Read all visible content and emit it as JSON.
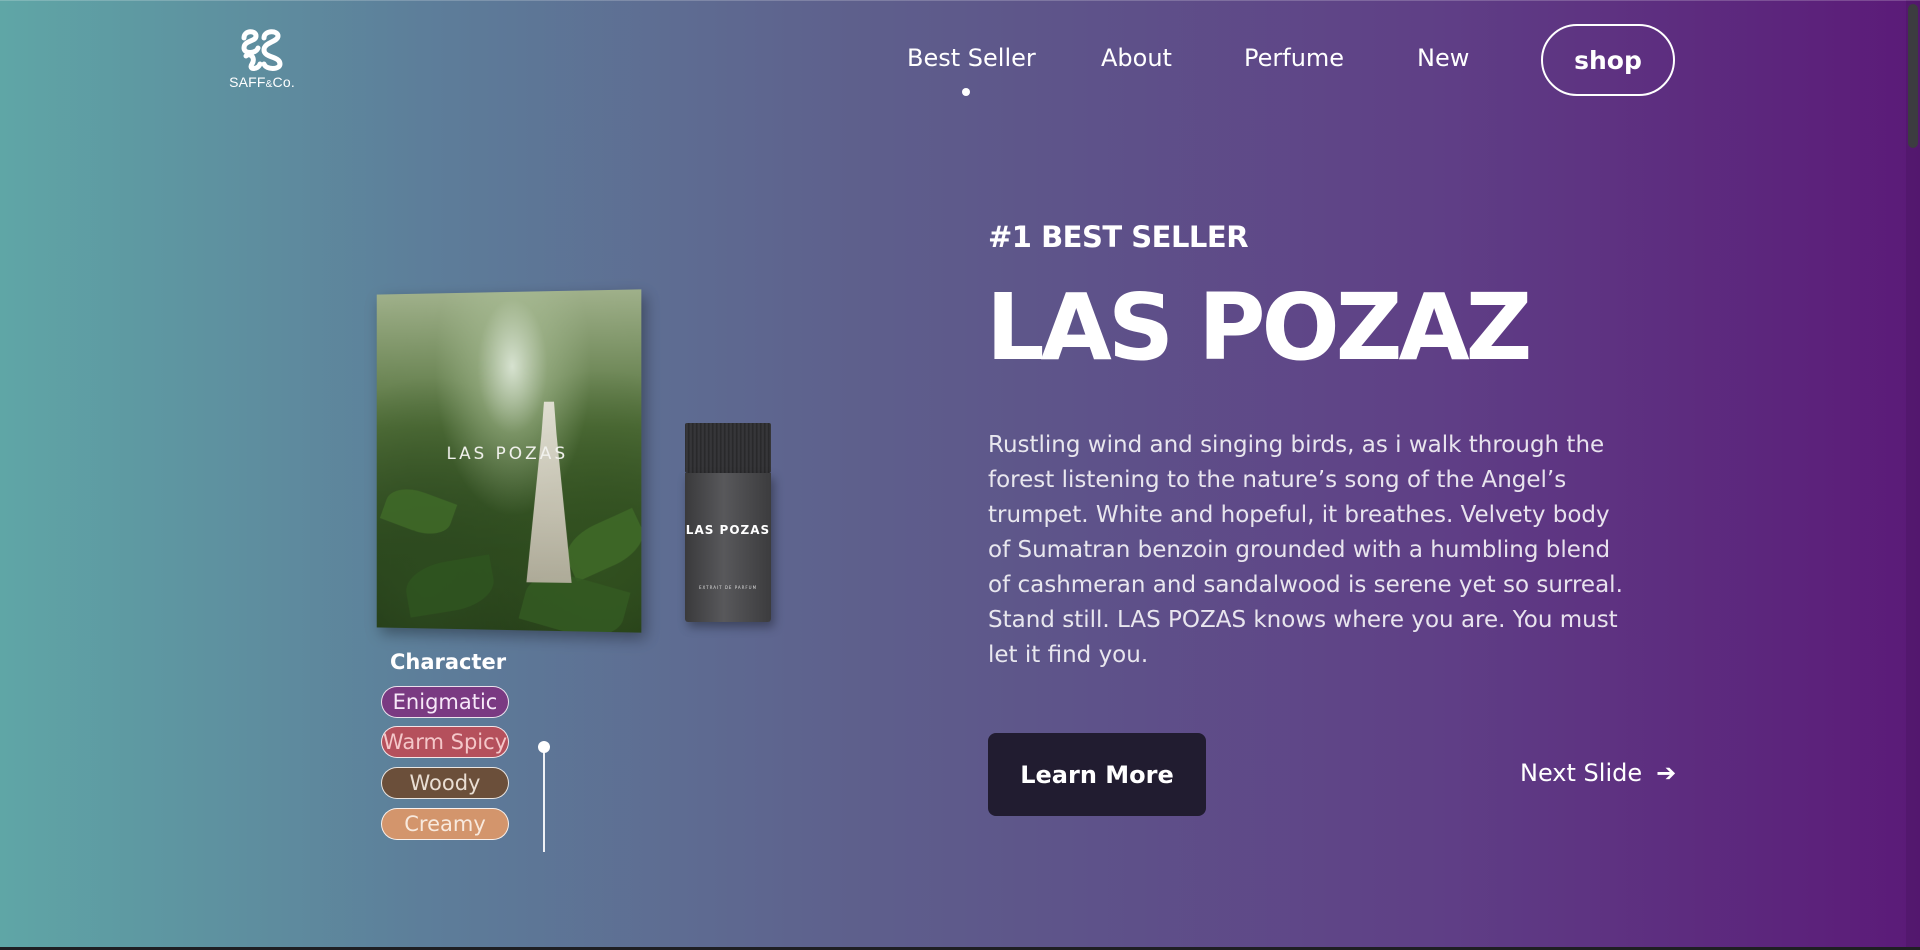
{
  "brand": {
    "name": "SAFF",
    "amp": "&",
    "suffix": "Co."
  },
  "nav": {
    "items": [
      {
        "label": "Best Seller"
      },
      {
        "label": "About"
      },
      {
        "label": "Perfume"
      },
      {
        "label": "New"
      }
    ],
    "shop_label": "shop",
    "active": "Best Seller"
  },
  "product": {
    "box_label": "LAS POZAS",
    "bottle_label": "LAS POZAS",
    "bottle_sub": "EXTRAIT DE PARFUM"
  },
  "character": {
    "title": "Character",
    "tags": [
      {
        "label": "Enigmatic",
        "color": "#7a3a82",
        "text_color": "#f6e8f8"
      },
      {
        "label": "Warm Spicy",
        "color": "#b5505c",
        "text_color": "#f4c7c9"
      },
      {
        "label": "Woody",
        "color": "#6b4f3a",
        "text_color": "#e9ded3"
      },
      {
        "label": "Creamy",
        "color": "#d3956c",
        "text_color": "#f8e9dd"
      }
    ]
  },
  "hero": {
    "eyebrow": "#1 BEST SELLER",
    "title": "LAS POZAZ",
    "description": "Rustling wind and singing birds, as i walk through the forest listening to the nature’s song of the Angel’s trumpet. White and hopeful, it breathes. Velvety body of Sumatran benzoin grounded with a humbling blend of cashmeran and sandalwood is serene yet so surreal. Stand still. LAS POZAS knows where you are. You must let it find you.",
    "learn_more_label": "Learn More",
    "next_slide_label": "Next Slide",
    "next_icon": "arrow-right-icon"
  },
  "colors": {
    "accent_dark": "#211c30",
    "gradient_start": "#5fa6a6",
    "gradient_end": "#5b1a78"
  }
}
